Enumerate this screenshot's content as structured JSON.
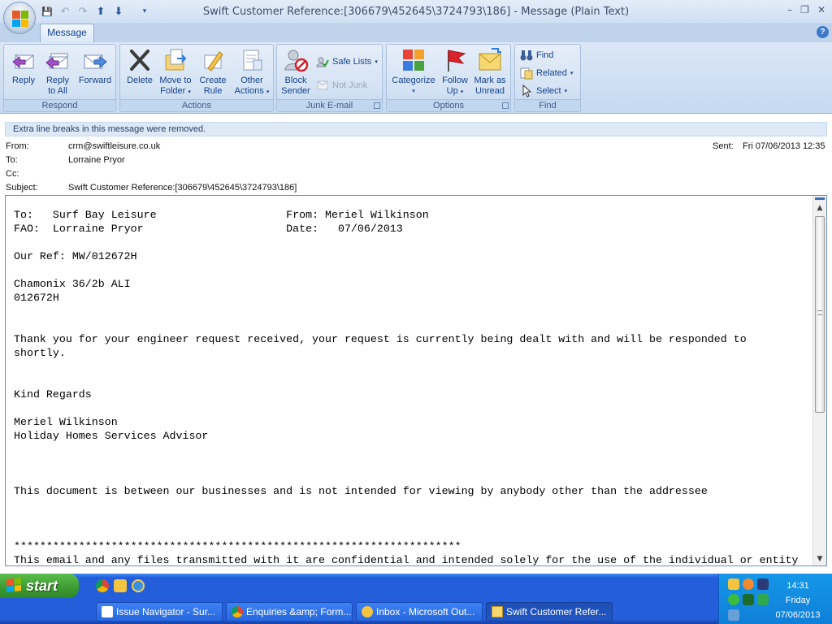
{
  "window": {
    "title": "Swift Customer Reference:[306679\\452645\\3724793\\186] - Message (Plain Text)",
    "minimize": "–",
    "maximize": "❐",
    "close": "✕"
  },
  "qat": {
    "save": "💾",
    "undo": "↶",
    "redo": "↷",
    "up": "⬆",
    "down": "⬇",
    "more": "▾"
  },
  "tabs": {
    "message": "Message",
    "help": "?"
  },
  "ribbon": {
    "respond": {
      "label": "Respond",
      "reply": "Reply",
      "reply_all_1": "Reply",
      "reply_all_2": "to All",
      "forward": "Forward"
    },
    "actions": {
      "label": "Actions",
      "delete": "Delete",
      "move_1": "Move to",
      "move_2": "Folder",
      "rule_1": "Create",
      "rule_2": "Rule",
      "other_1": "Other",
      "other_2": "Actions"
    },
    "junk": {
      "label": "Junk E-mail",
      "block_1": "Block",
      "block_2": "Sender",
      "safe_lists": "Safe Lists",
      "not_junk": "Not Junk"
    },
    "options": {
      "label": "Options",
      "categorize": "Categorize",
      "follow_1": "Follow",
      "follow_2": "Up",
      "mark_1": "Mark as",
      "mark_2": "Unread"
    },
    "find": {
      "label": "Find",
      "find": "Find",
      "related": "Related",
      "select": "Select"
    }
  },
  "infobar": "Extra line breaks in this message were removed.",
  "header": {
    "from_label": "From:",
    "from": "crm@swiftleisure.co.uk",
    "to_label": "To:",
    "to": "Lorraine Pryor",
    "cc_label": "Cc:",
    "cc": "",
    "subject_label": "Subject:",
    "subject": "Swift Customer Reference:[306679\\452645\\3724793\\186]",
    "sent_label": "Sent:",
    "sent": "Fri 07/06/2013 12:35"
  },
  "body": "To:   Surf Bay Leisure                    From: Meriel Wilkinson\nFAO:  Lorraine Pryor                      Date:   07/06/2013\n\nOur Ref: MW/012672H\n\nChamonix 36/2b ALI\n012672H\n\n\nThank you for your engineer request received, your request is currently being dealt with and will be responded to\nshortly.\n\n\nKind Regards\n\nMeriel Wilkinson\nHoliday Homes Services Advisor\n\n\n\nThis document is between our businesses and is not intended for viewing by anybody other than the addressee\n\n\n\n*********************************************************************\nThis email and any files transmitted with it are confidential and intended solely for the use of the individual or entity",
  "scrollbar": {
    "up": "▲",
    "down": "▼"
  },
  "taskbar": {
    "start": "start",
    "tasks": [
      {
        "label": "Issue Navigator - Sur...",
        "icon": "jira-icon"
      },
      {
        "label": "Enquiries &amp; Form...",
        "icon": "chrome-icon"
      },
      {
        "label": "Inbox - Microsoft Out...",
        "icon": "outlook-icon"
      },
      {
        "label": "Swift Customer Refer...",
        "icon": "email-message-icon"
      }
    ],
    "clock": {
      "time": "14:31",
      "day": "Friday",
      "date": "07/06/2013"
    }
  },
  "colors": {
    "accent": "#15428b",
    "taskbar": "#245edb",
    "start": "#3c9a31"
  }
}
